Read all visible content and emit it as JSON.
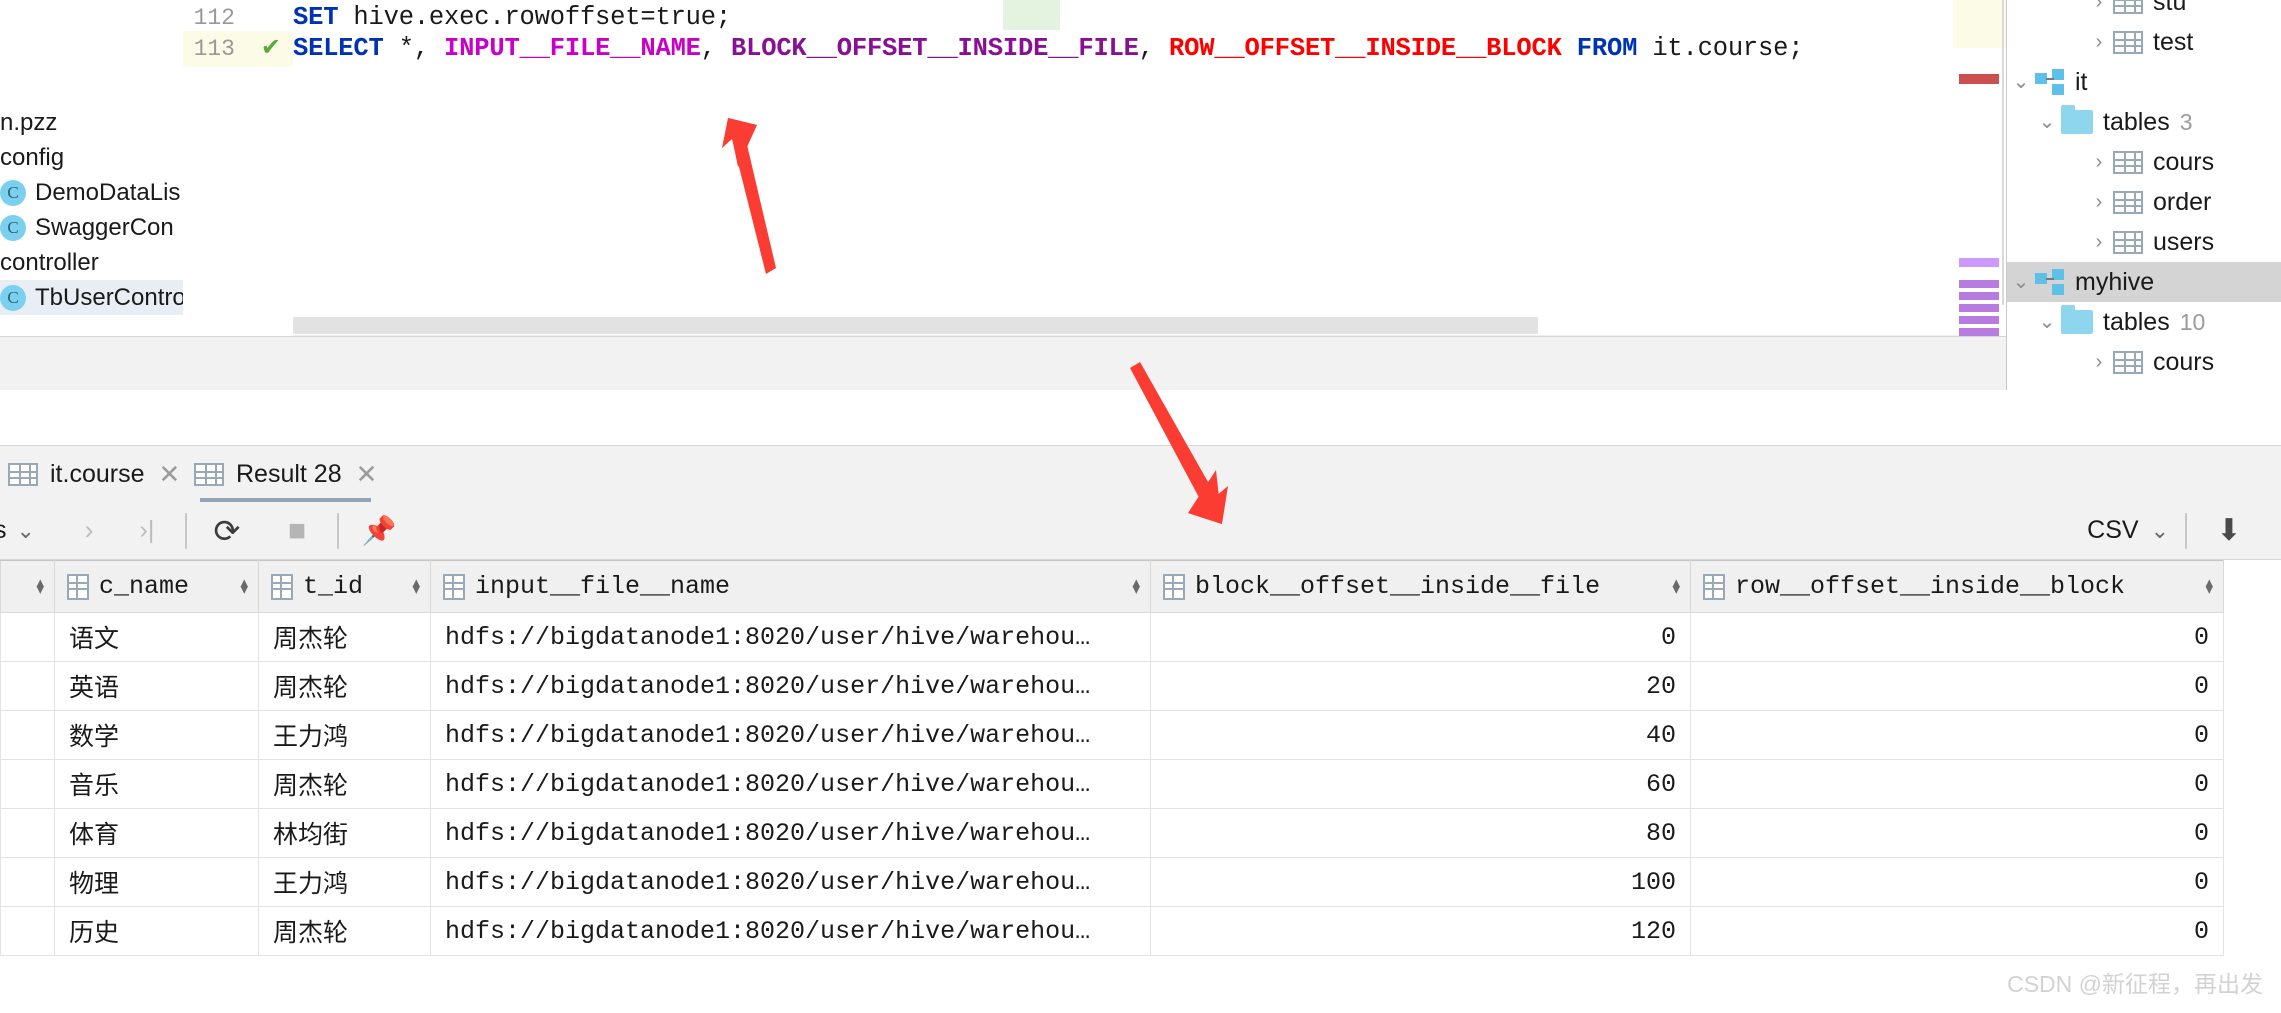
{
  "editor": {
    "lines": [
      {
        "number": "112",
        "has_check": false,
        "tokens": [
          {
            "t": "SET",
            "c": "kw"
          },
          {
            "t": " hive.exec.rowoffset=true;",
            "c": "ident"
          }
        ]
      },
      {
        "number": "113",
        "has_check": true,
        "check_glyph": "✔",
        "tokens": [
          {
            "t": "SELECT",
            "c": "kw"
          },
          {
            "t": " *, ",
            "c": "punc"
          },
          {
            "t": "INPUT__FILE__NAME",
            "c": "vcol-magenta"
          },
          {
            "t": ", ",
            "c": "punc"
          },
          {
            "t": "BLOCK__OFFSET__INSIDE__FILE",
            "c": "vcol-purple"
          },
          {
            "t": ", ",
            "c": "punc"
          },
          {
            "t": "ROW__OFFSET__INSIDE__BLOCK",
            "c": "vcol-red"
          },
          {
            "t": " ",
            "c": "punc"
          },
          {
            "t": "FROM",
            "c": "kw"
          },
          {
            "t": " it.course;",
            "c": "ident"
          }
        ]
      }
    ]
  },
  "project_panel": {
    "items": [
      {
        "label": "n.pzz",
        "icon": "none",
        "selected": false
      },
      {
        "label": "config",
        "icon": "none",
        "selected": false
      },
      {
        "label": "DemoDataLis",
        "icon": "java-class-icon",
        "icon_glyph": "C",
        "selected": false
      },
      {
        "label": "SwaggerCon",
        "icon": "java-class-icon",
        "icon_glyph": "C",
        "selected": false
      },
      {
        "label": "controller",
        "icon": "none",
        "selected": false
      },
      {
        "label": "TbUserContro",
        "icon": "java-class-icon",
        "icon_glyph": "C",
        "selected": true
      }
    ]
  },
  "database_tree": {
    "nodes": [
      {
        "label": "stu",
        "icon": "table-icon",
        "chevron": "collapsed",
        "indent": 3,
        "count": "",
        "selected": false
      },
      {
        "label": "test",
        "icon": "table-icon",
        "chevron": "collapsed",
        "indent": 3,
        "count": "",
        "selected": false
      },
      {
        "label": "it",
        "icon": "schema-icon",
        "chevron": "expanded",
        "indent": 1,
        "count": "",
        "selected": false
      },
      {
        "label": "tables",
        "icon": "folder-icon",
        "chevron": "expanded",
        "indent": 2,
        "count": "3",
        "selected": false
      },
      {
        "label": "cours",
        "icon": "table-icon",
        "chevron": "collapsed",
        "indent": 3,
        "count": "",
        "selected": false
      },
      {
        "label": "order",
        "icon": "table-icon",
        "chevron": "collapsed",
        "indent": 3,
        "count": "",
        "selected": false
      },
      {
        "label": "users",
        "icon": "table-icon",
        "chevron": "collapsed",
        "indent": 3,
        "count": "",
        "selected": false
      },
      {
        "label": "myhive",
        "icon": "schema-icon",
        "chevron": "expanded",
        "indent": 1,
        "count": "",
        "selected": true
      },
      {
        "label": "tables",
        "icon": "folder-icon",
        "chevron": "expanded",
        "indent": 2,
        "count": "10",
        "selected": false
      },
      {
        "label": "cours",
        "icon": "table-icon",
        "chevron": "collapsed",
        "indent": 3,
        "count": "",
        "selected": false
      }
    ]
  },
  "results": {
    "tabs": [
      {
        "label": "it.course",
        "close": "✕",
        "active": false
      },
      {
        "label": "Result 28",
        "close": "✕",
        "active": true
      }
    ],
    "toolbar": {
      "rows_label": "s",
      "rows_chevron": "⌄",
      "next_page": "›",
      "last_page": "›|",
      "refresh": "⟳",
      "stop": "■",
      "pin": "📌",
      "export_format": "CSV",
      "export_chevron": "⌄",
      "download": "⬇"
    },
    "columns": [
      {
        "name": "",
        "type": "rownum"
      },
      {
        "name": "c_name",
        "type": "text"
      },
      {
        "name": "t_id",
        "type": "text"
      },
      {
        "name": "input__file__name",
        "type": "text"
      },
      {
        "name": "block__offset__inside__file",
        "type": "number"
      },
      {
        "name": "row__offset__inside__block",
        "type": "number"
      }
    ],
    "rows": [
      [
        "",
        "语文",
        "周杰轮",
        "hdfs://bigdatanode1:8020/user/hive/warehou…",
        "0",
        "0"
      ],
      [
        "",
        "英语",
        "周杰轮",
        "hdfs://bigdatanode1:8020/user/hive/warehou…",
        "20",
        "0"
      ],
      [
        "",
        "数学",
        "王力鸿",
        "hdfs://bigdatanode1:8020/user/hive/warehou…",
        "40",
        "0"
      ],
      [
        "",
        "音乐",
        "周杰轮",
        "hdfs://bigdatanode1:8020/user/hive/warehou…",
        "60",
        "0"
      ],
      [
        "",
        "体育",
        "林均街",
        "hdfs://bigdatanode1:8020/user/hive/warehou…",
        "80",
        "0"
      ],
      [
        "",
        "物理",
        "王力鸿",
        "hdfs://bigdatanode1:8020/user/hive/warehou…",
        "100",
        "0"
      ],
      [
        "",
        "历史",
        "周杰轮",
        "hdfs://bigdatanode1:8020/user/hive/warehou…",
        "120",
        "0"
      ]
    ]
  },
  "annotations": {
    "arrow_up_color": "#fa3c32",
    "arrow_down_color": "#fa3c32"
  },
  "watermark": {
    "text": "CSDN @新征程，再出发"
  }
}
